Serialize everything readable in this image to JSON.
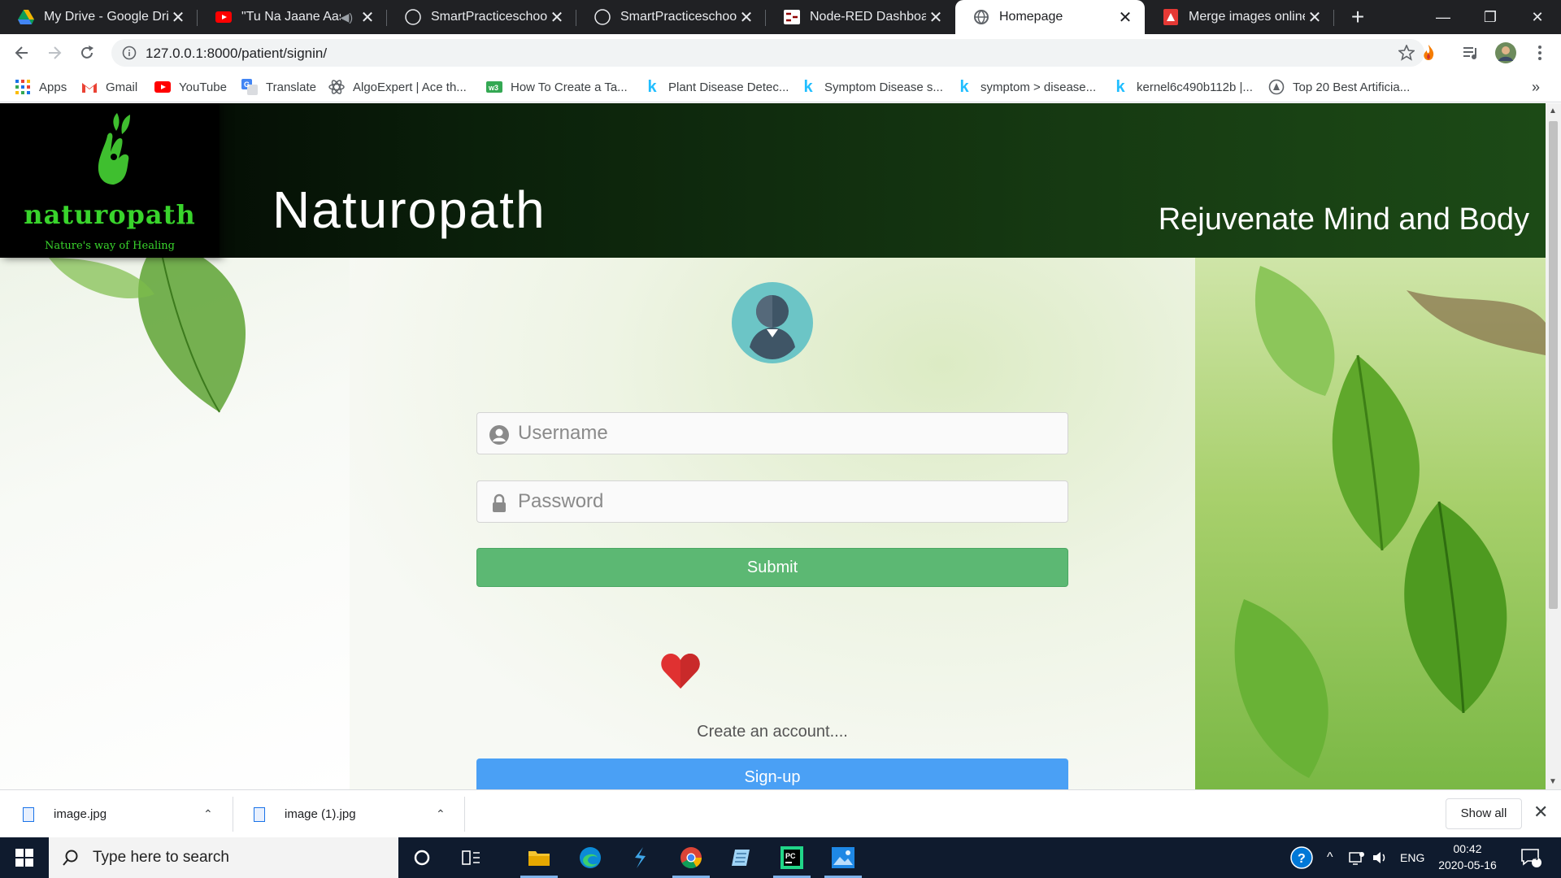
{
  "browser": {
    "tabs": [
      {
        "title": "My Drive - Google Drive",
        "icon": "google-drive-icon"
      },
      {
        "title": "\"Tu Na Jaane Aas Paas Hai Khuda",
        "icon": "youtube-icon",
        "muted": true
      },
      {
        "title": "SmartPracticeschool/IISPS",
        "icon": "github-icon"
      },
      {
        "title": "SmartPracticeschool/IISPS",
        "icon": "github-icon"
      },
      {
        "title": "Node-RED Dashboard",
        "icon": "node-red-icon"
      },
      {
        "title": "Homepage",
        "icon": "globe-icon",
        "active": true
      },
      {
        "title": "Merge images online",
        "icon": "merge-images-icon"
      }
    ],
    "new_tab_label": "+",
    "address_url": "127.0.0.1:8000/patient/signin/",
    "bookmarks": [
      {
        "label": "Apps",
        "icon": "apps-grid-icon"
      },
      {
        "label": "Gmail",
        "icon": "gmail-icon"
      },
      {
        "label": "YouTube",
        "icon": "youtube-icon"
      },
      {
        "label": "Translate",
        "icon": "translate-icon"
      },
      {
        "label": "AlgoExpert | Ace th...",
        "icon": "algoexpert-icon"
      },
      {
        "label": "How To Create a Ta...",
        "icon": "spreadsheet-icon"
      },
      {
        "label": "Plant Disease Detec...",
        "icon": "kaggle-icon"
      },
      {
        "label": "Symptom Disease s...",
        "icon": "kaggle-icon"
      },
      {
        "label": "symptom > disease...",
        "icon": "kaggle-icon"
      },
      {
        "label": "kernel6c490b112b |...",
        "icon": "kaggle-icon"
      },
      {
        "label": "Top 20 Best Artificia...",
        "icon": "website-icon"
      }
    ],
    "bookmarks_overflow": "»"
  },
  "site": {
    "brand_word": "naturopath",
    "brand_tagline": "Nature's way of Healing",
    "title": "Naturopath",
    "slogan": "Rejuvenate Mind and Body"
  },
  "form": {
    "username_placeholder": "Username",
    "password_placeholder": "Password",
    "submit_label": "Submit",
    "create_account_text": "Create an account....",
    "signup_label": "Sign-up"
  },
  "downloads": {
    "items": [
      {
        "name": "image.jpg"
      },
      {
        "name": "image (1).jpg"
      }
    ],
    "show_all_label": "Show all"
  },
  "taskbar": {
    "search_placeholder": "Type here to search",
    "language": "ENG",
    "time": "00:42",
    "date": "2020-05-16",
    "notification_count": "4"
  },
  "colors": {
    "submit": "#5cb873",
    "signup": "#4aa0f5",
    "brand_green": "#39d42c",
    "header_dark": "#0a1f0a"
  }
}
